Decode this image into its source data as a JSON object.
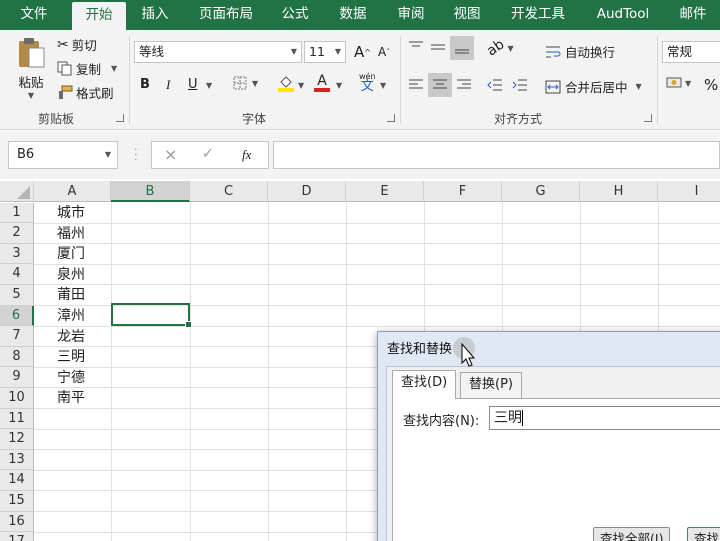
{
  "tabs": [
    "文件",
    "开始",
    "插入",
    "页面布局",
    "公式",
    "数据",
    "审阅",
    "视图",
    "开发工具",
    "AudTool",
    "邮件"
  ],
  "ribbon": {
    "clipboard": {
      "paste": "粘贴",
      "cut": "剪切",
      "copy": "复制",
      "format_painter": "格式刷",
      "group_label": "剪贴板"
    },
    "font": {
      "font_name": "等线",
      "font_size": "11",
      "bold": "B",
      "italic": "I",
      "underline": "U",
      "increase": "A",
      "decrease": "A",
      "phonetic_top": "wén",
      "phonetic_bottom": "文",
      "group_label": "字体"
    },
    "alignment": {
      "wrap_text": "自动换行",
      "merge_center": "合并后居中",
      "group_label": "对齐方式"
    },
    "number": {
      "format": "常规",
      "percent": "%",
      "group_label": ""
    }
  },
  "formula_bar": {
    "name_box": "B6",
    "cancel": "×",
    "enter": "✓",
    "fx": "fx",
    "formula": ""
  },
  "columns": [
    "A",
    "B",
    "C",
    "D",
    "E",
    "F",
    "G",
    "H",
    "I"
  ],
  "rows": [
    "1",
    "2",
    "3",
    "4",
    "5",
    "6",
    "7",
    "8",
    "9",
    "10",
    "11",
    "12",
    "13",
    "14",
    "15",
    "16",
    "17"
  ],
  "cells_a": [
    "城市",
    "福州",
    "厦门",
    "泉州",
    "莆田",
    "漳州",
    "龙岩",
    "三明",
    "宁德",
    "南平"
  ],
  "selected_cell": "B6",
  "dialog": {
    "title": "查找和替换",
    "tab_find": "查找(D)",
    "tab_replace": "替换(P)",
    "find_label": "查找内容(N):",
    "find_value": "三明",
    "btn_find_all": "查找全部(I)",
    "btn_find_next": "查找"
  },
  "colors": {
    "accent": "#217346",
    "ribbon": "#f3f3f3"
  }
}
